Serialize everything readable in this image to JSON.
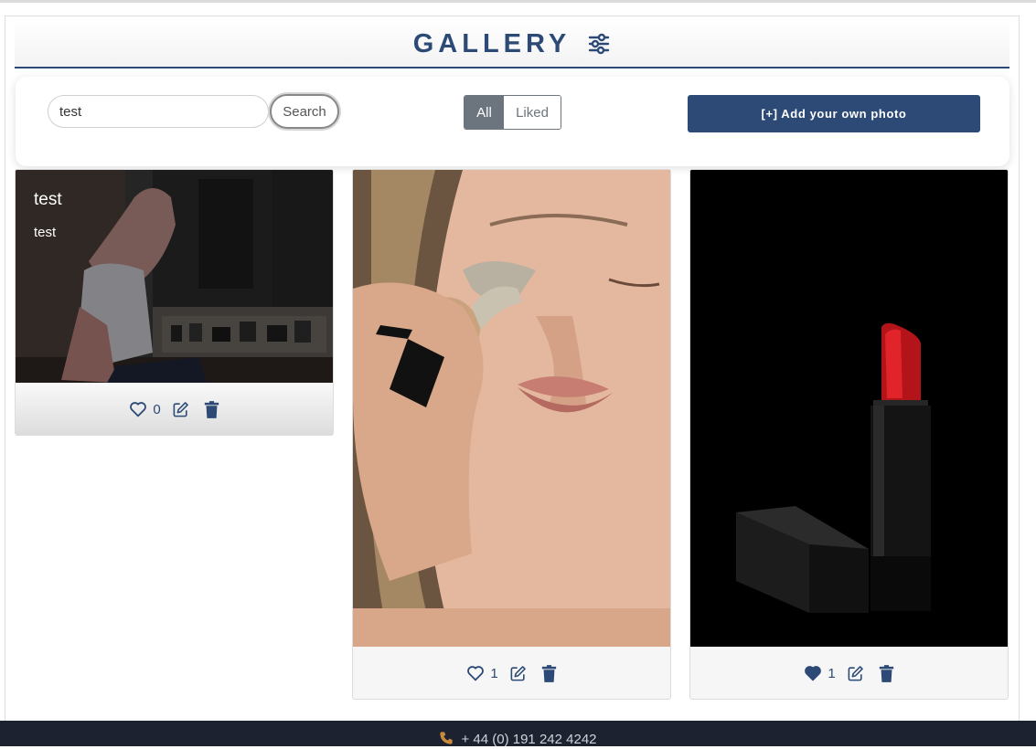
{
  "header": {
    "title": "GALLERY",
    "filter_icon": "sliders-icon"
  },
  "toolbar": {
    "search_value": "test",
    "search_label": "Search",
    "filter_all_label": "All",
    "filter_liked_label": "Liked",
    "add_label": "[+] Add your own photo"
  },
  "cards": [
    {
      "title": "test",
      "description": "test",
      "likes": "0",
      "liked": false,
      "photo": "woman applying makeup at vanity"
    },
    {
      "likes": "1",
      "liked": false,
      "photo": "woman curling eyelashes"
    },
    {
      "likes": "1",
      "liked": true,
      "photo": "red lipstick on black background"
    }
  ],
  "footer": {
    "phone": "+ 44 (0) 191 242 4242"
  },
  "colors": {
    "brand": "#2c4a75",
    "footer_bg": "#1d2230",
    "toggle_active": "#6c757d"
  }
}
